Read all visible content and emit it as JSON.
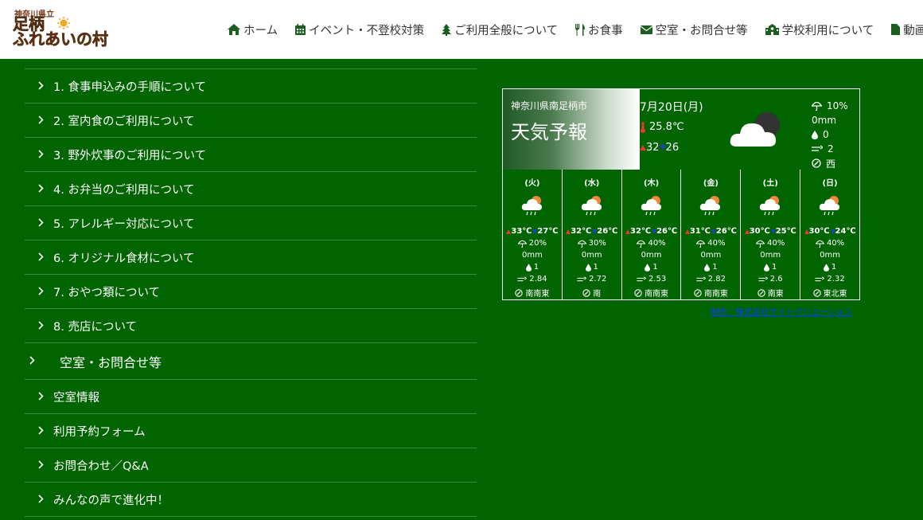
{
  "logo": {
    "small": "神奈川県立",
    "line1": "足柄",
    "line2": "ふれあいの村"
  },
  "nav": [
    {
      "label": "ホーム",
      "icon": "home-icon"
    },
    {
      "label": "イベント・不登校対策",
      "icon": "calendar-icon"
    },
    {
      "label": "ご利用全般について",
      "icon": "tree-icon"
    },
    {
      "label": "お食事",
      "icon": "utensils-icon"
    },
    {
      "label": "空室・お問合せ等",
      "icon": "envelope-icon"
    },
    {
      "label": "学校利用について",
      "icon": "school-icon"
    },
    {
      "label": "動画・",
      "icon": "file-icon"
    }
  ],
  "menu": {
    "meal_items": [
      "1. 食事申込みの手順について",
      "2. 室内食のご利用について",
      "3. 野外炊事のご利用について",
      "4. お弁当のご利用について",
      "5. アレルギー対応について",
      "6. オリジナル食材について",
      "7. おやつ類について",
      "8. 売店について"
    ],
    "section_label": "空室・お問合せ等",
    "contact_items": [
      "空室情報",
      "利用予約フォーム",
      "お問合わせ／Q&A",
      "みんなの声で進化中！"
    ]
  },
  "weather": {
    "prefecture": "神奈川県南足柄市",
    "title": "天気予報",
    "date": "7月20日(月)",
    "temp": "25.8℃",
    "high": "32",
    "low": "26",
    "pop": "10%",
    "rain": "0mm",
    "humidity": "0",
    "wind": "2",
    "direction": "西",
    "days": [
      {
        "day": "(火)",
        "high": "33℃",
        "low": "27℃",
        "pop": "20%",
        "rain": "0mm",
        "hum": "1",
        "wind": "2.84",
        "dir": "南南東"
      },
      {
        "day": "(水)",
        "high": "32℃",
        "low": "26℃",
        "pop": "30%",
        "rain": "0mm",
        "hum": "1",
        "wind": "2.72",
        "dir": "南"
      },
      {
        "day": "(木)",
        "high": "32℃",
        "low": "26℃",
        "pop": "40%",
        "rain": "0mm",
        "hum": "1",
        "wind": "2.53",
        "dir": "南南東"
      },
      {
        "day": "(金)",
        "high": "31℃",
        "low": "26℃",
        "pop": "40%",
        "rain": "0mm",
        "hum": "1",
        "wind": "2.82",
        "dir": "南南東"
      },
      {
        "day": "(土)",
        "high": "30℃",
        "low": "25℃",
        "pop": "40%",
        "rain": "0mm",
        "hum": "1",
        "wind": "2.6",
        "dir": "南東"
      },
      {
        "day": "(日)",
        "high": "30℃",
        "low": "24℃",
        "pop": "40%",
        "rain": "0mm",
        "hum": "1",
        "wind": "2.32",
        "dir": "東北東"
      }
    ],
    "credit": "制作：株式会社サイトクリエーション"
  },
  "colors": {
    "background": "#006400",
    "header": "#ffffff",
    "nav_icon": "#1b5e20",
    "high_temp": "#e53935",
    "low_temp": "#1e40c8",
    "credit_link": "#0a3cff"
  }
}
